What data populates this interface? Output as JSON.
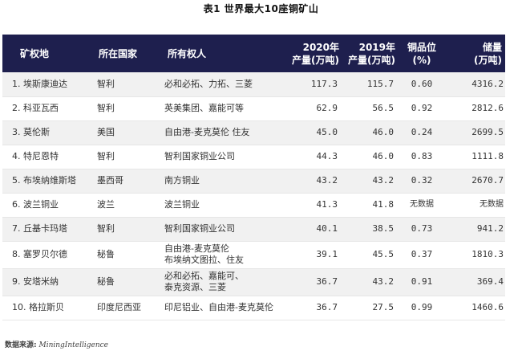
{
  "title": "表1 世界最大10座铜矿山",
  "headers": {
    "mine": "矿权地",
    "country": "所在国家",
    "owner": "所有权人",
    "prod2020_line1": "2020年",
    "prod2020_line2": "产量(万吨)",
    "prod2019_line1": "2019年",
    "prod2019_line2": "产量(万吨)",
    "grade_line1": "铜品位",
    "grade_line2": "(%)",
    "reserve_line1": "储量",
    "reserve_line2": "(万吨)"
  },
  "rows": [
    {
      "mine": "1. 埃斯康迪达",
      "country": "智利",
      "owner": [
        "必和必拓、力拓、三菱"
      ],
      "p2020": "117.3",
      "p2019": "115.7",
      "grade": "0.60",
      "reserve": "4316.2"
    },
    {
      "mine": "2. 科亚瓦西",
      "country": "智利",
      "owner": [
        "英美集团、嘉能可等"
      ],
      "p2020": "62.9",
      "p2019": "56.5",
      "grade": "0.92",
      "reserve": "2812.6"
    },
    {
      "mine": "3. 莫伦斯",
      "country": "美国",
      "owner": [
        "自由港-麦克莫伦 住友"
      ],
      "p2020": "45.0",
      "p2019": "46.0",
      "grade": "0.24",
      "reserve": "2699.5"
    },
    {
      "mine": "4. 特尼恩特",
      "country": "智利",
      "owner": [
        "智利国家铜业公司"
      ],
      "p2020": "44.3",
      "p2019": "46.0",
      "grade": "0.83",
      "reserve": "1111.8"
    },
    {
      "mine": "5. 布埃纳维斯塔",
      "country": "墨西哥",
      "owner": [
        "南方铜业"
      ],
      "p2020": "43.2",
      "p2019": "43.2",
      "grade": "0.32",
      "reserve": "2670.7"
    },
    {
      "mine": "6. 波兰铜业",
      "country": "波兰",
      "owner": [
        "波兰铜业"
      ],
      "p2020": "41.3",
      "p2019": "41.8",
      "grade": "无数据",
      "reserve": "无数据"
    },
    {
      "mine": "7. 丘基卡玛塔",
      "country": "智利",
      "owner": [
        "智利国家铜业公司"
      ],
      "p2020": "40.1",
      "p2019": "38.5",
      "grade": "0.73",
      "reserve": "941.2"
    },
    {
      "mine": "8. 塞罗贝尔德",
      "country": "秘鲁",
      "owner": [
        "自由港-麦克莫伦",
        "布埃纳文图拉、住友"
      ],
      "p2020": "39.1",
      "p2019": "45.5",
      "grade": "0.37",
      "reserve": "1810.3"
    },
    {
      "mine": "9. 安塔米纳",
      "country": "秘鲁",
      "owner": [
        "必和必拓、嘉能可、",
        "泰克资源、三菱"
      ],
      "p2020": "36.7",
      "p2019": "43.2",
      "grade": "0.91",
      "reserve": "369.4"
    },
    {
      "mine": "10. 格拉斯贝",
      "country": "印度尼西亚",
      "owner": [
        "印尼铝业、自由港-麦克莫伦"
      ],
      "p2020": "36.7",
      "p2019": "27.5",
      "grade": "0.99",
      "reserve": "1460.6"
    }
  ],
  "source": {
    "label": "数据来源:",
    "name": "MiningIntelligence"
  }
}
